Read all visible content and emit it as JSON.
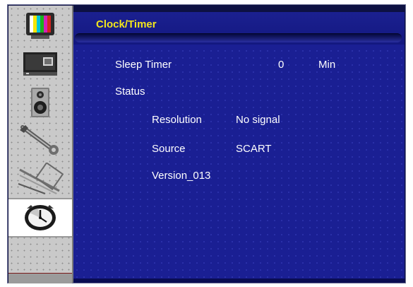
{
  "menu": {
    "title": "Clock/Timer",
    "sleep_timer": {
      "label": "Sleep Timer",
      "value": "0",
      "unit": "Min"
    },
    "status": {
      "label": "Status",
      "resolution_label": "Resolution",
      "resolution_value": "No signal",
      "source_label": "Source",
      "source_value": "SCART",
      "version": "Version_013"
    }
  },
  "sidebar": {
    "items": [
      {
        "icon": "tv-picture-icon"
      },
      {
        "icon": "monitor-screen-icon"
      },
      {
        "icon": "speaker-sound-icon"
      },
      {
        "icon": "wrench-setup-icon"
      },
      {
        "icon": "tools-feature-icon"
      },
      {
        "icon": "clock-timer-icon",
        "active": true
      }
    ]
  },
  "colors": {
    "title": "#f2e51c",
    "text": "#ffffff",
    "panel": "#1a1f93",
    "sidebar": "#c9c9c9"
  }
}
